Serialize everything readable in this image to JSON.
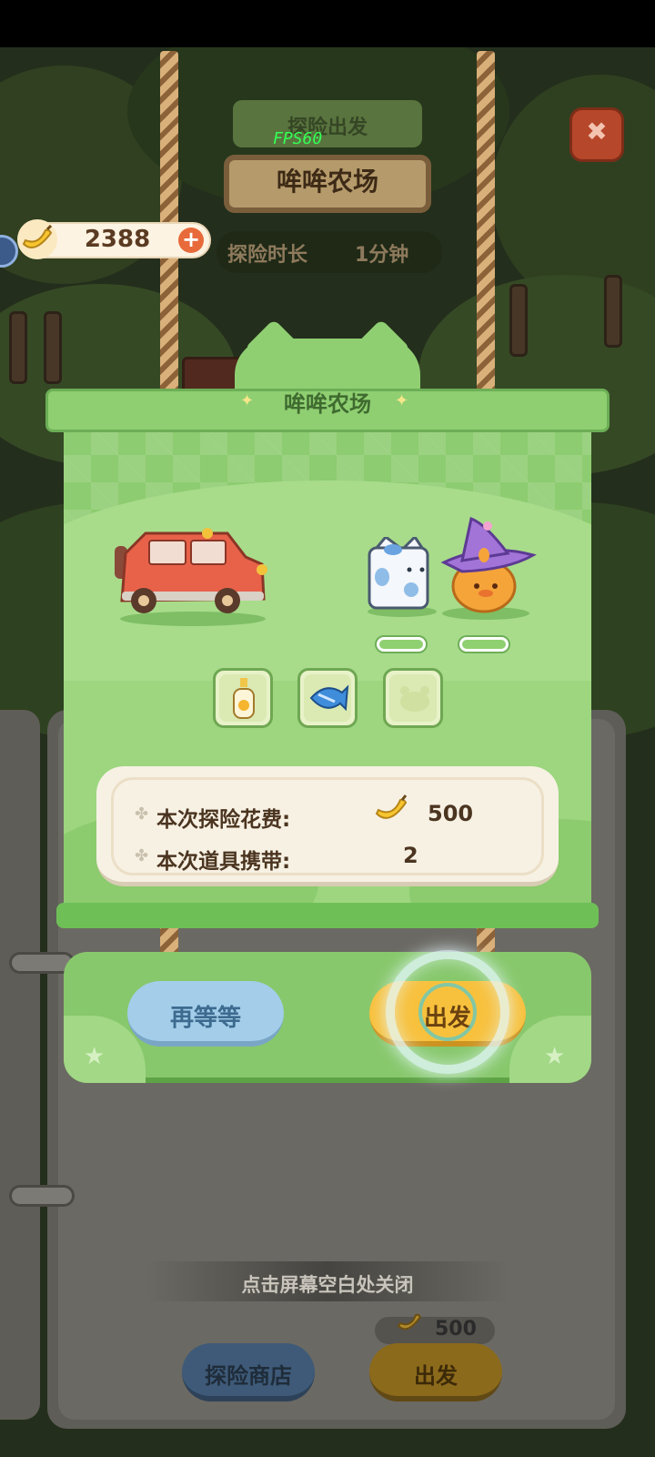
{
  "top_header": {
    "ribbon_text": "探险出发",
    "fps": "FPS60",
    "location_sign": "哞哞农场"
  },
  "currency": {
    "amount": "2388",
    "plus": "+",
    "icon": "banana-icon"
  },
  "duration": {
    "label": "探险时长",
    "value": "1分钟"
  },
  "dialog": {
    "title": "哞哞农场",
    "vehicle_icon": "red-jeep-icon",
    "characters": [
      "milk-carton-cat-icon",
      "witch-cat-icon"
    ],
    "item_slots": [
      "honey-bottle-icon",
      "blue-fish-snack-icon",
      "empty-slot-icon"
    ],
    "info": {
      "cost_label": "本次探险花费:",
      "cost_value": "500",
      "items_label": "本次道具携带:",
      "items_value": "2"
    },
    "wait_button": "再等等",
    "depart_button": "出发"
  },
  "background_panel": {
    "close_hint": "点击屏幕空白处关闭",
    "cost_small": "500",
    "shop_button": "探险商店",
    "go_button": "出发"
  },
  "colors": {
    "dialog_green": "#9dd67f",
    "depart_yellow": "#f8c13d",
    "wait_blue": "#a3cde9",
    "text_brown": "#4b3520"
  }
}
